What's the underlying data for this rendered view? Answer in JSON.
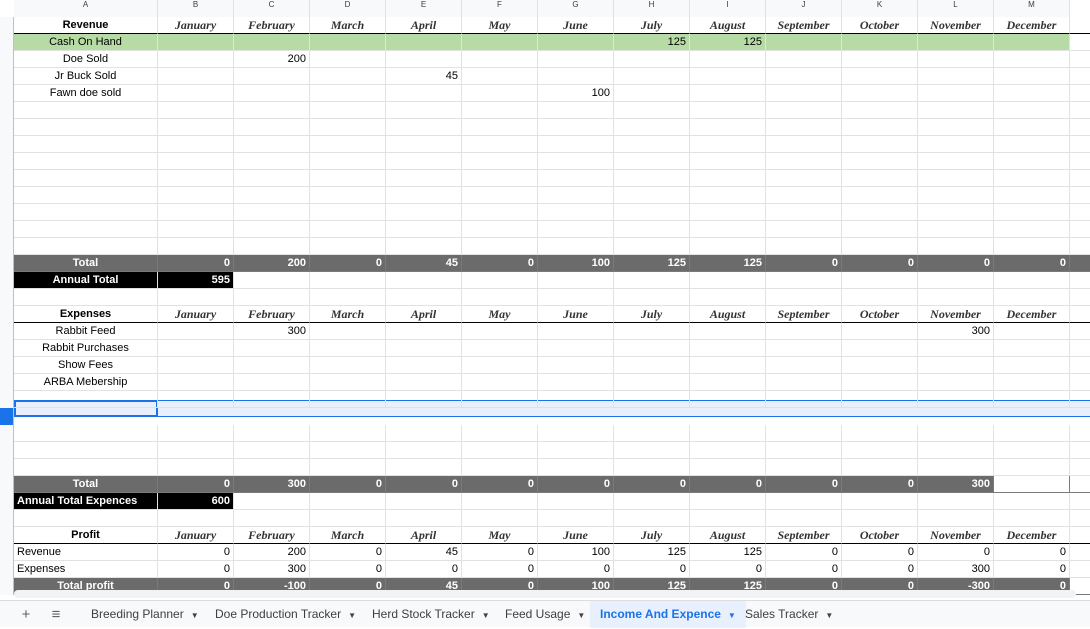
{
  "columns": [
    "A",
    "B",
    "C",
    "D",
    "E",
    "F",
    "G",
    "H",
    "I",
    "J",
    "K",
    "L",
    "M"
  ],
  "months": [
    "January",
    "February",
    "March",
    "April",
    "May",
    "June",
    "July",
    "August",
    "September",
    "October",
    "November",
    "December"
  ],
  "revenue": {
    "header": "Revenue",
    "rows": [
      {
        "label": "Cash On Hand",
        "values": [
          "",
          "",
          "",
          "",
          "",
          "",
          125,
          125,
          "",
          "",
          "",
          ""
        ]
      },
      {
        "label": "Doe Sold",
        "values": [
          "",
          200,
          "",
          "",
          "",
          "",
          "",
          "",
          "",
          "",
          "",
          ""
        ]
      },
      {
        "label": "Jr Buck Sold",
        "values": [
          "",
          "",
          "",
          45,
          "",
          "",
          "",
          "",
          "",
          "",
          "",
          ""
        ]
      },
      {
        "label": "Fawn doe sold",
        "values": [
          "",
          "",
          "",
          "",
          "",
          100,
          "",
          "",
          "",
          "",
          "",
          ""
        ]
      }
    ],
    "total_label": "Total",
    "totals": [
      0,
      200,
      0,
      45,
      0,
      100,
      125,
      125,
      0,
      0,
      0,
      0
    ],
    "annual_label": "Annual Total",
    "annual_value": 595
  },
  "expenses": {
    "header": "Expenses",
    "rows": [
      {
        "label": "Rabbit Feed",
        "values": [
          "",
          300,
          "",
          "",
          "",
          "",
          "",
          "",
          "",
          "",
          300,
          ""
        ]
      },
      {
        "label": "Rabbit Purchases",
        "values": [
          "",
          "",
          "",
          "",
          "",
          "",
          "",
          "",
          "",
          "",
          "",
          ""
        ]
      },
      {
        "label": "Show Fees",
        "values": [
          "",
          "",
          "",
          "",
          "",
          "",
          "",
          "",
          "",
          "",
          "",
          ""
        ]
      },
      {
        "label": "ARBA Mebership",
        "values": [
          "",
          "",
          "",
          "",
          "",
          "",
          "",
          "",
          "",
          "",
          "",
          ""
        ]
      }
    ],
    "total_label": "Total",
    "totals": [
      0,
      300,
      0,
      0,
      0,
      0,
      0,
      0,
      0,
      0,
      300
    ],
    "annual_label": "Annual Total Expences",
    "annual_value": 600
  },
  "profit": {
    "header": "Profit",
    "rows": [
      {
        "label": "Revenue",
        "values": [
          0,
          200,
          0,
          45,
          0,
          100,
          125,
          125,
          0,
          0,
          0,
          0
        ]
      },
      {
        "label": "Expenses",
        "values": [
          0,
          300,
          0,
          0,
          0,
          0,
          0,
          0,
          0,
          0,
          300,
          0
        ]
      }
    ],
    "total_label": "Total profit",
    "totals": [
      0,
      -100,
      0,
      45,
      0,
      100,
      125,
      125,
      0,
      0,
      -300,
      0
    ]
  },
  "tabbar": {
    "add_icon": "plus-icon",
    "list_icon": "menu-lines-icon",
    "tabs": [
      {
        "label": "Breeding Planner",
        "active": false
      },
      {
        "label": "Doe Production Tracker",
        "active": false
      },
      {
        "label": "Herd Stock Tracker",
        "active": false
      },
      {
        "label": "Feed Usage",
        "active": false
      },
      {
        "label": "Income And Expence",
        "active": true
      },
      {
        "label": "Sales Tracker",
        "active": false
      }
    ]
  },
  "colors": {
    "green_row": "#b7dba5",
    "total_row": "#6b6b6b",
    "annual_cell": "#000000",
    "active_tab": "#1a73e8"
  }
}
